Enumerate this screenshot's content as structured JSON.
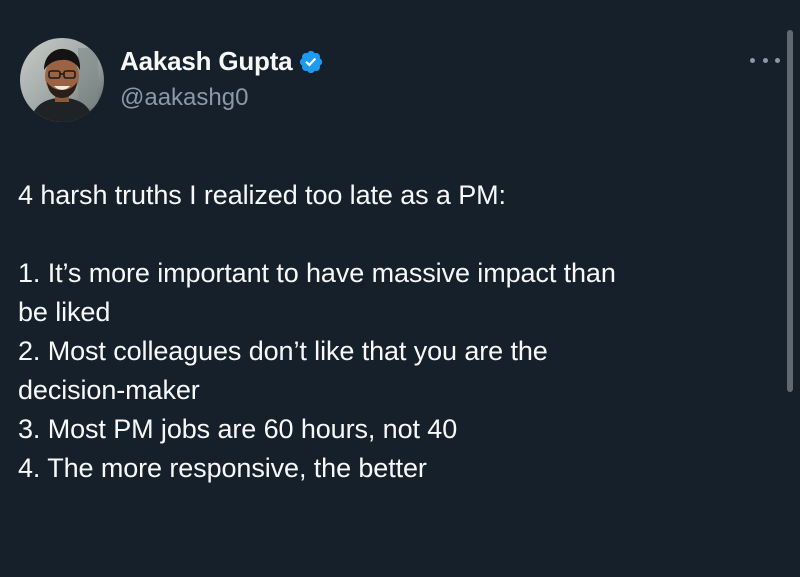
{
  "author": {
    "display_name": "Aakash Gupta",
    "handle": "@aakashg0",
    "verified": true,
    "badge_color": "#1d9bf0"
  },
  "tweet": {
    "intro": "4 harsh truths I realized too late as a PM:",
    "lines": [
      "1. It’s more important to have massive impact than",
      "be liked",
      "2. Most colleagues don’t like that you are the",
      "decision-maker",
      "3. Most PM jobs are 60 hours, not 40",
      "4. The more responsive, the better"
    ]
  },
  "icons": {
    "verified": "verified-badge-icon",
    "more": "more-options-icon"
  },
  "theme": {
    "background": "#15202b",
    "text": "#f7f9f9",
    "secondary_text": "#8b98a5"
  }
}
